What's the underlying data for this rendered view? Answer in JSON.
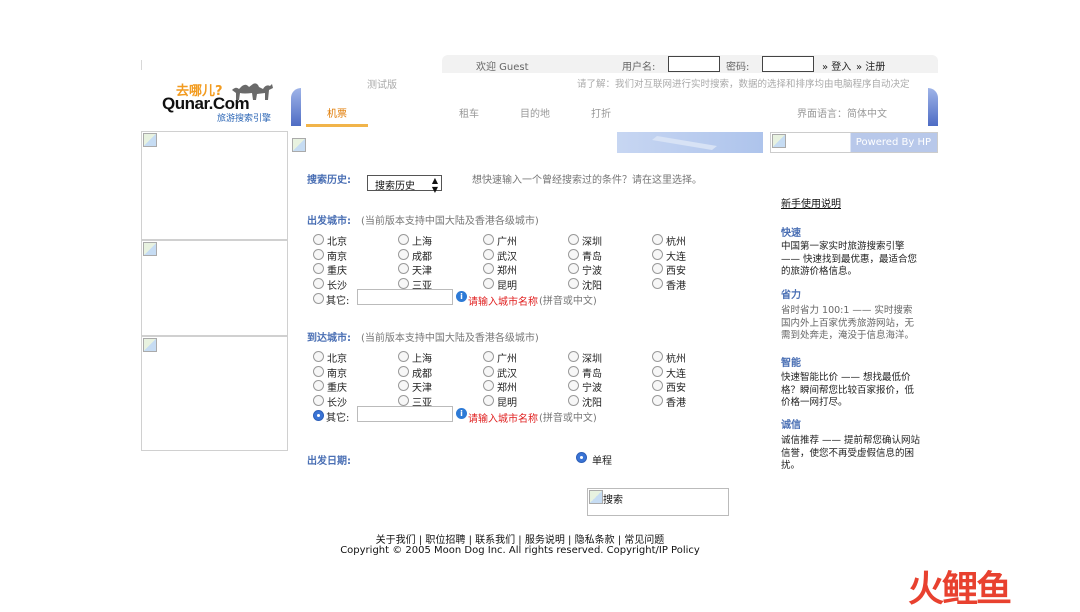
{
  "header": {
    "welcome": "欢迎 Guest",
    "username_label": "用户名:",
    "password_label": "密码:",
    "login_link": "登入",
    "register_link": "注册",
    "beta_label": "测试版",
    "disclaimer": "请了解：我们对互联网进行实时搜索，数据的选择和排序均由电脑程序自动决定",
    "language": "界面语言：简体中文"
  },
  "logo": {
    "top_text": "去哪儿?",
    "brand": "Qunar.Com",
    "tagline": "旅游搜索引擎"
  },
  "tabs": [
    {
      "label": "机票",
      "active": true
    },
    {
      "label": "租车",
      "active": false
    },
    {
      "label": "目的地",
      "active": false
    },
    {
      "label": "打折",
      "active": false
    }
  ],
  "powered_by": "Powered By HP",
  "history": {
    "label": "搜索历史:",
    "select_value": "搜索历史",
    "hint": "想快速输入一个曾经搜索过的条件？请在这里选择。"
  },
  "departure": {
    "label": "出发城市:",
    "note": "(当前版本支持中国大陆及香港各级城市)",
    "cities": [
      "北京",
      "上海",
      "广州",
      "深圳",
      "杭州",
      "南京",
      "成都",
      "武汉",
      "青岛",
      "大连",
      "重庆",
      "天津",
      "郑州",
      "宁波",
      "西安",
      "长沙",
      "三亚",
      "昆明",
      "沈阳",
      "香港"
    ],
    "other_label": "其它:",
    "other_hint": "请输入城市名称",
    "other_format": "(拼音或中文)",
    "selected": "none"
  },
  "arrival": {
    "label": "到达城市:",
    "note": "(当前版本支持中国大陆及香港各级城市)",
    "cities": [
      "北京",
      "上海",
      "广州",
      "深圳",
      "杭州",
      "南京",
      "成都",
      "武汉",
      "青岛",
      "大连",
      "重庆",
      "天津",
      "郑州",
      "宁波",
      "西安",
      "长沙",
      "三亚",
      "昆明",
      "沈阳",
      "香港"
    ],
    "other_label": "其它:",
    "other_hint": "请输入城市名称",
    "other_format": "(拼音或中文)",
    "selected": "其它"
  },
  "date": {
    "label": "出发日期:",
    "trip_type": "单程"
  },
  "search_button": "搜索",
  "sidebar": {
    "guide_link": "新手使用说明",
    "sections": [
      {
        "title": "快速",
        "text": "中国第一家实时旅游搜索引擎 —— 快速找到最优惠，最适合您的旅游价格信息。",
        "gray": false
      },
      {
        "title": "省力",
        "text": "省时省力 100:1 —— 实时搜索国内外上百家优秀旅游网站，无需到处奔走，淹没于信息海洋。",
        "gray": true
      },
      {
        "title": "智能",
        "text": "快速智能比价 —— 想找最低价格？瞬间帮您比较百家报价，低价格一网打尽。",
        "gray": false
      },
      {
        "title": "诚信",
        "text": "诚信推荐 —— 提前帮您确认网站信誉，使您不再受虚假信息的困扰。",
        "gray": false
      }
    ]
  },
  "footer": {
    "links": "关于我们 | 职位招聘 | 联系我们 | 服务说明 | 隐私条款 | 常见问题",
    "copyright": "Copyright © 2005 Moon Dog Inc. All rights reserved. Copyright/IP Policy"
  },
  "watermark": "火鲤鱼",
  "colors": {
    "accent": "#e07a00",
    "link_blue": "#4a6fb4",
    "hint_red": "#e02020",
    "radio_on": "#3a74d6"
  }
}
